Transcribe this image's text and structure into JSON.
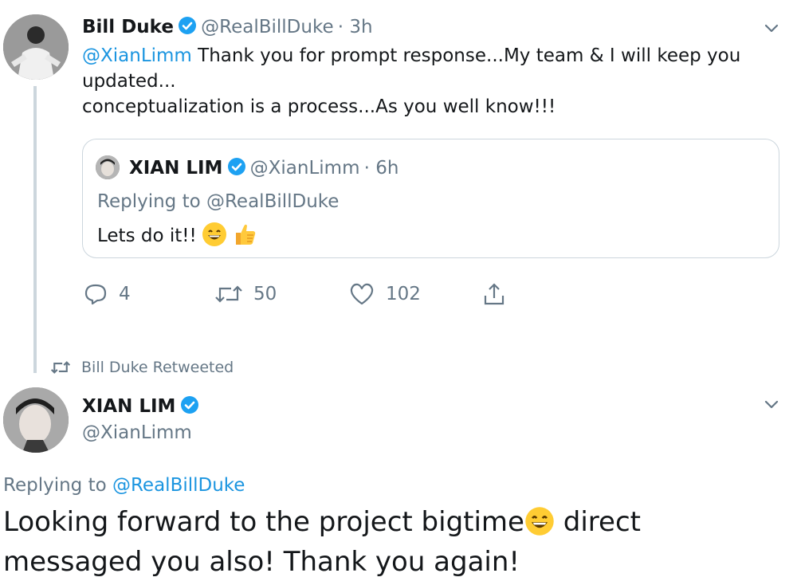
{
  "tweet1": {
    "author_name": "Bill Duke",
    "author_handle": "@RealBillDuke",
    "time": "· 3h",
    "mention": "@XianLimm",
    "text_line1": " Thank you for prompt response...My team & I will keep you",
    "text_line2": "updated...",
    "text_line3": "conceptualization is a process...As you well know!!!",
    "quoted": {
      "author_name": "XIAN LIM",
      "author_handle": "@XianLimm",
      "time": "· 6h",
      "replying_prefix": "Replying to ",
      "replying_to": "@RealBillDuke",
      "text": "Lets do it!!"
    },
    "actions": {
      "replies": "4",
      "retweets": "50",
      "likes": "102"
    }
  },
  "retweet_context": "Bill Duke Retweeted",
  "tweet2": {
    "author_name": "XIAN LIM",
    "author_handle": "@XianLimm",
    "replying_prefix": "Replying to ",
    "replying_to": "@RealBillDuke",
    "text_line1a": "Looking forward to the project bigtime",
    "text_line1b": " direct",
    "text_line2": "messaged you also! Thank you again!"
  },
  "colors": {
    "link": "#1b95e0",
    "secondary": "#657786",
    "border": "#ccd6dd",
    "verified": "#1da1f2"
  }
}
